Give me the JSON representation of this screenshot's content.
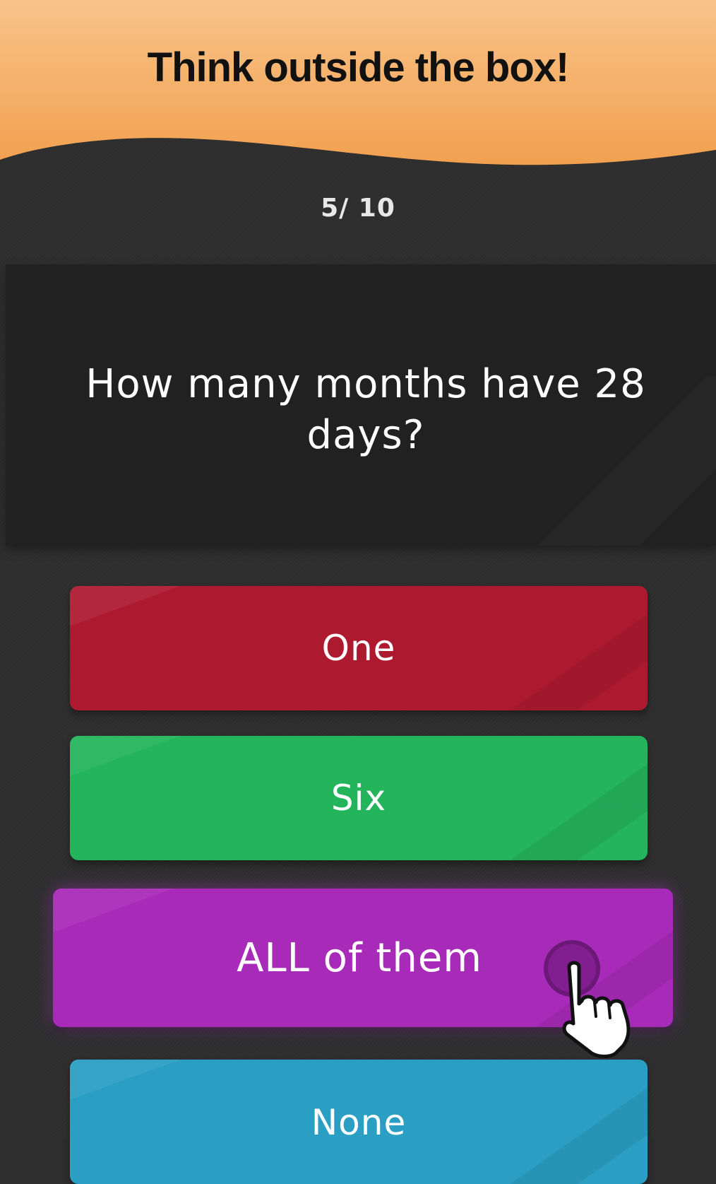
{
  "header": {
    "title": "Think outside the box!",
    "color": "#f5a552"
  },
  "progress": {
    "text": "5/ 10",
    "current": 5,
    "total": 10
  },
  "question": {
    "text": "How many months have 28 days?"
  },
  "answers": [
    {
      "label": "One",
      "color": "#ad1a30"
    },
    {
      "label": "Six",
      "color": "#24b45b"
    },
    {
      "label": "ALL of them",
      "color": "#a82ab8",
      "selected": true
    },
    {
      "label": "None",
      "color": "#2a9ec3"
    }
  ],
  "icons": {
    "tap": "pointing-hand-icon"
  }
}
